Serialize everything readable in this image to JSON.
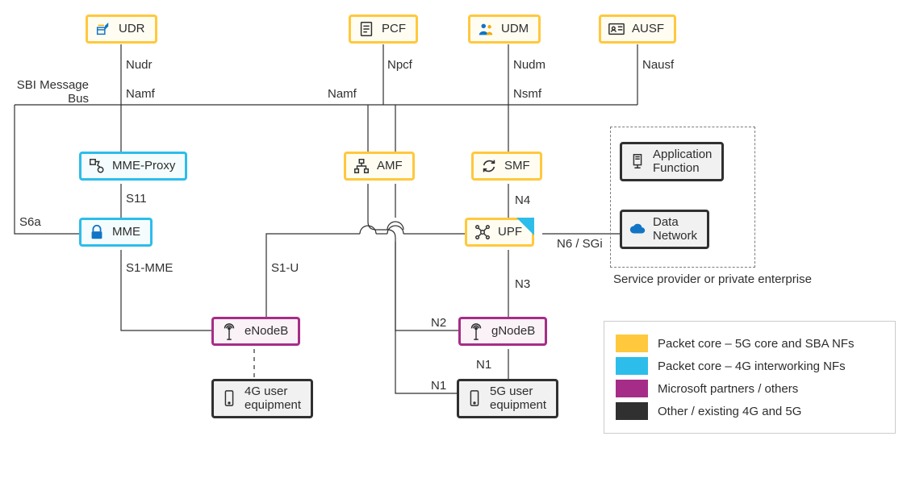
{
  "nodes": {
    "udr": {
      "text": "UDR"
    },
    "pcf": {
      "text": "PCF"
    },
    "udm": {
      "text": "UDM"
    },
    "ausf": {
      "text": "AUSF"
    },
    "mmeproxy": {
      "text": "MME-Proxy"
    },
    "amf": {
      "text": "AMF"
    },
    "smf": {
      "text": "SMF"
    },
    "appfn": {
      "text": "Application\nFunction"
    },
    "mme": {
      "text": "MME"
    },
    "upf": {
      "text": "UPF"
    },
    "datanet": {
      "text": "Data\nNetwork"
    },
    "enodeb": {
      "text": "eNodeB"
    },
    "gnodeb": {
      "text": "gNodeB"
    },
    "ue4g": {
      "text": "4G user\nequipment"
    },
    "ue5g": {
      "text": "5G user\nequipment"
    }
  },
  "labels": {
    "sbi": "SBI Message\nBus",
    "nudr": "Nudr",
    "namf1": "Namf",
    "npcf": "Npcf",
    "namf2": "Namf",
    "nudm": "Nudm",
    "nsmf": "Nsmf",
    "nausf": "Nausf",
    "s11": "S11",
    "s6a": "S6a",
    "s1mme": "S1-MME",
    "s1u": "S1-U",
    "n4": "N4",
    "n6": "N6 / SGi",
    "n3": "N3",
    "n2": "N2",
    "n1a": "N1",
    "n1b": "N1",
    "provider": "Service provider or\nprivate enterprise"
  },
  "legend": {
    "yellow": "Packet core – 5G core and SBA NFs",
    "blue": "Packet core – 4G interworking NFs",
    "purple": "Microsoft partners / others",
    "black": "Other / existing 4G and 5G"
  }
}
